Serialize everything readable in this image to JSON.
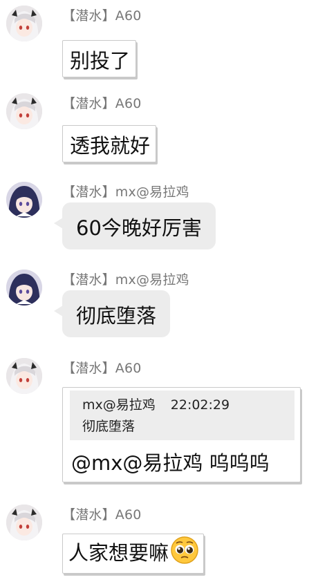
{
  "messages": [
    {
      "sender": "【潜水】A60",
      "avatar": "white-hair-avatar",
      "text": "别投了"
    },
    {
      "sender": "【潜水】A60",
      "avatar": "white-hair-avatar",
      "text": "透我就好"
    },
    {
      "sender": "【潜水】mx@易拉鸡",
      "avatar": "dark-hair-avatar",
      "text": "60今晚好厉害"
    },
    {
      "sender": "【潜水】mx@易拉鸡",
      "avatar": "dark-hair-avatar",
      "text": "彻底堕落"
    },
    {
      "sender": "【潜水】A60",
      "avatar": "white-hair-avatar",
      "quote": {
        "author": "mx@易拉鸡",
        "time": "22:02:29",
        "text": "彻底堕落"
      },
      "text": "@mx@易拉鸡 呜呜呜"
    },
    {
      "sender": "【潜水】A60",
      "avatar": "white-hair-avatar",
      "text": "人家想要嘛",
      "emoji": "pleading-face-emoji"
    }
  ],
  "colors": {
    "sender_text": "#777777",
    "grey_bubble": "#ececec",
    "white_bubble_border": "#c9c9c9",
    "quote_bg": "#ededed"
  }
}
